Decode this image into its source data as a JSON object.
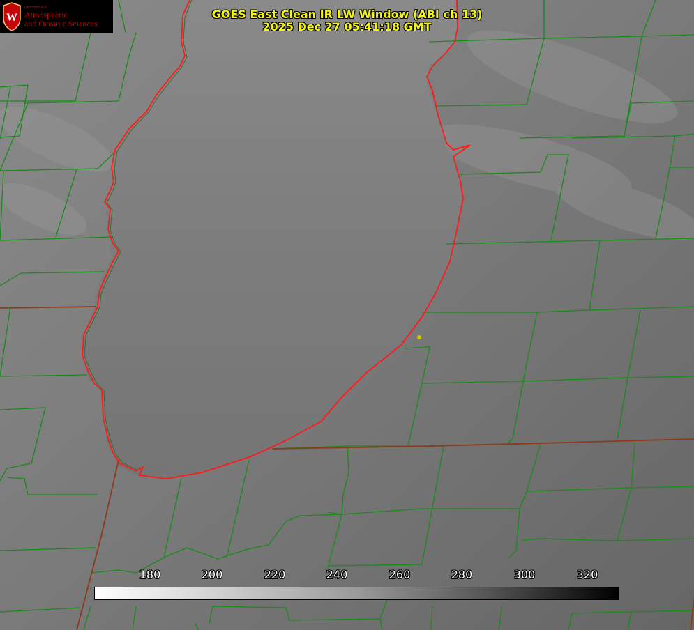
{
  "title": {
    "line1": "GOES East Clean IR LW Window (ABI ch 13)",
    "line2": "2025 Dec 27 05:41:18 GMT"
  },
  "logo": {
    "dept": "Department of",
    "line1": "Atmospheric",
    "line2": "and Oceanic Sciences",
    "seal_letter": "W"
  },
  "colorbar": {
    "ticks": [
      "180",
      "200",
      "220",
      "240",
      "260",
      "280",
      "300",
      "320"
    ],
    "min_value": 162,
    "max_value": 330,
    "colors": [
      "#ffffff",
      "#000000"
    ]
  },
  "colors": {
    "background": "#6e6e6e",
    "lake": "#7a7a7a",
    "county_lines": "#1a8a1a",
    "state_lines": "#8b3a1a",
    "shoreline": "#ff1a1a",
    "title": "#f5f50a",
    "marker": "#d4c400"
  }
}
